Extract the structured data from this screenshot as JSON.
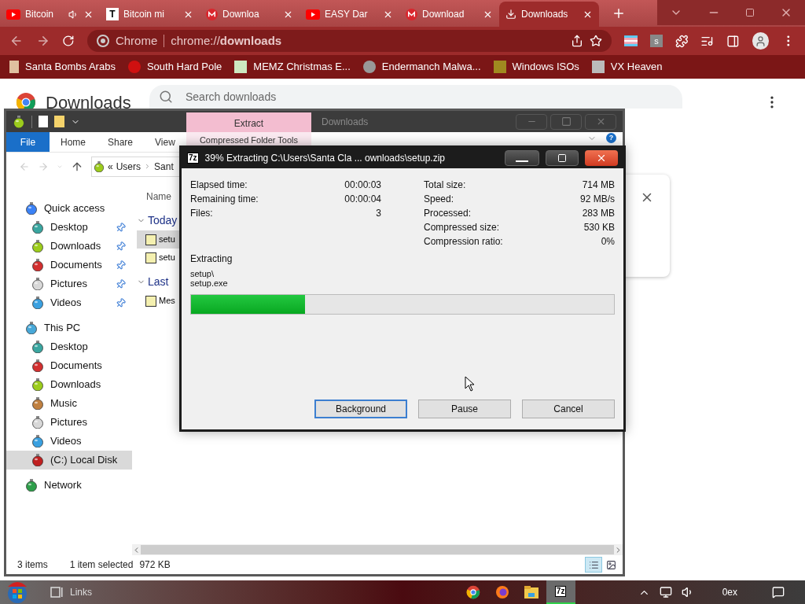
{
  "browser": {
    "tabs": [
      {
        "title": "Bitcoin",
        "selected": false,
        "audio": true
      },
      {
        "title": "Bitcoin mi",
        "selected": false,
        "audio": false,
        "favicon_text": "T"
      },
      {
        "title": "Downloa",
        "selected": false,
        "audio": false
      },
      {
        "title": "EASY Dar",
        "selected": false,
        "audio": false
      },
      {
        "title": "Download",
        "selected": false,
        "audio": false
      },
      {
        "title": "Downloads",
        "selected": true,
        "audio": false
      }
    ],
    "omnibox": {
      "site": "Chrome",
      "url": "chrome://**downloads**"
    },
    "extension_letter": "s",
    "bookmarks": [
      "Santa Bombs Arabs",
      "South Hard Pole",
      "MEMZ Christmas E...",
      "Endermanch Malwa...",
      "Windows ISOs",
      "VX Heaven"
    ],
    "page": {
      "title": "Downloads",
      "search": {
        "placeholder": "Search downloads"
      }
    }
  },
  "explorer": {
    "title": "Downloads",
    "context_header": "Extract",
    "ribbon_tabs": [
      {
        "label": "File",
        "kind": "file"
      },
      {
        "label": "Home",
        "kind": "tab"
      },
      {
        "label": "Share",
        "kind": "tab"
      },
      {
        "label": "View",
        "kind": "tab"
      },
      {
        "label": "Compressed Folder Tools",
        "kind": "contextual"
      }
    ],
    "help_text": "?",
    "breadcrumb": [
      "«",
      "Users",
      "Sant"
    ],
    "nav": [
      {
        "label": "Quick access",
        "selected": false,
        "color": "#3b82f6",
        "children": [
          {
            "label": "Desktop",
            "selected": false,
            "pinned": true,
            "color": "#3aa6a0"
          },
          {
            "label": "Downloads",
            "selected": false,
            "pinned": true,
            "color": "#9ccc1c"
          },
          {
            "label": "Documents",
            "selected": false,
            "pinned": true,
            "color": "#d23030"
          },
          {
            "label": "Pictures",
            "selected": false,
            "pinned": true,
            "color": "#d8d8d8"
          },
          {
            "label": "Videos",
            "selected": false,
            "pinned": true,
            "color": "#3aa0e0"
          }
        ]
      },
      {
        "label": "This PC",
        "selected": false,
        "color": "#48a8d8",
        "children": [
          {
            "label": "Desktop",
            "selected": false,
            "pinned": false,
            "color": "#3aa6a0"
          },
          {
            "label": "Documents",
            "selected": false,
            "pinned": false,
            "color": "#d23030"
          },
          {
            "label": "Downloads",
            "selected": false,
            "pinned": false,
            "color": "#9ccc1c"
          },
          {
            "label": "Music",
            "selected": false,
            "pinned": false,
            "color": "#c08040"
          },
          {
            "label": "Pictures",
            "selected": false,
            "pinned": false,
            "color": "#d8d8d8"
          },
          {
            "label": "Videos",
            "selected": false,
            "pinned": false,
            "color": "#3aa0e0"
          },
          {
            "label": "(C:) Local Disk",
            "selected": true,
            "pinned": false,
            "color": "#c02020"
          }
        ]
      },
      {
        "label": "Network",
        "selected": false,
        "color": "#2e9e4a"
      }
    ],
    "column": "Name",
    "groups": [
      {
        "label": "Today",
        "items": [
          {
            "name": "setu",
            "selected": true
          },
          {
            "name": "setu",
            "selected": false
          }
        ]
      },
      {
        "label": "Last",
        "items": [
          {
            "name": "Mes",
            "selected": false
          }
        ]
      }
    ],
    "status": {
      "count": "3 items",
      "selection": "1 item selected",
      "size": "972 KB"
    },
    "views": [
      {
        "kind": "details",
        "selected": true
      },
      {
        "kind": "tiles",
        "selected": false
      }
    ]
  },
  "dialog": {
    "icon_text": "7z",
    "title": "39% Extracting C:\\Users\\Santa Cla ... ownloads\\setup.zip",
    "left_stats": [
      {
        "label": "Elapsed time:",
        "value": "00:00:03"
      },
      {
        "label": "Remaining time:",
        "value": "00:00:04"
      },
      {
        "label": "Files:",
        "value": "3"
      }
    ],
    "right_stats": [
      {
        "label": "Total size:",
        "value": "714 MB"
      },
      {
        "label": "Speed:",
        "value": "92 MB/s"
      },
      {
        "label": "Processed:",
        "value": "283 MB"
      },
      {
        "label": "Compressed size:",
        "value": "530 KB"
      },
      {
        "label": "Compression ratio:",
        "value": "0%"
      }
    ],
    "operation": "Extracting",
    "path": [
      "setup\\",
      "setup.exe"
    ],
    "progress": {
      "level": 0.27
    },
    "buttons": [
      {
        "label": "Background",
        "focused": true
      },
      {
        "label": "Pause",
        "focused": false
      },
      {
        "label": "Cancel",
        "focused": false
      }
    ]
  },
  "taskbar": {
    "toolbar": "Links",
    "apps": [
      {
        "kind": "chrome",
        "active": false
      },
      {
        "kind": "firefox",
        "active": false
      },
      {
        "kind": "folder",
        "active": false
      },
      {
        "kind": "archiver",
        "active": true,
        "text": "7z"
      }
    ],
    "clock": "0ex"
  }
}
